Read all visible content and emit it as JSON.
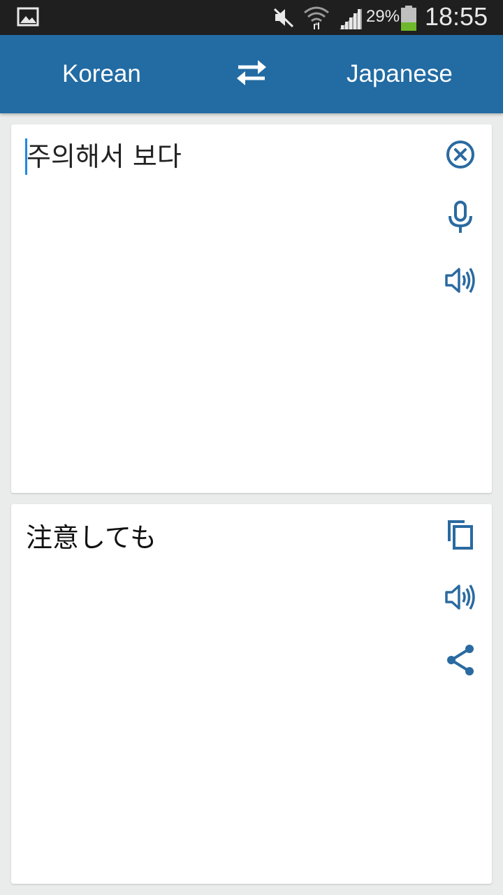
{
  "status_bar": {
    "battery_percent": "29%",
    "time": "18:55",
    "icons": [
      "gallery-icon",
      "mute-icon",
      "wifi-icon",
      "signal-icon",
      "battery-icon"
    ]
  },
  "app_bar": {
    "source_language": "Korean",
    "target_language": "Japanese",
    "swap_icon": "swap-arrows-icon",
    "color": "#226ba3"
  },
  "input_card": {
    "text": "주의해서 보다",
    "icons": [
      "clear-icon",
      "microphone-icon",
      "speaker-icon"
    ]
  },
  "output_card": {
    "text": "注意しても",
    "icons": [
      "copy-icon",
      "speaker-icon",
      "share-icon"
    ]
  },
  "accent_color": "#2a6aa0"
}
